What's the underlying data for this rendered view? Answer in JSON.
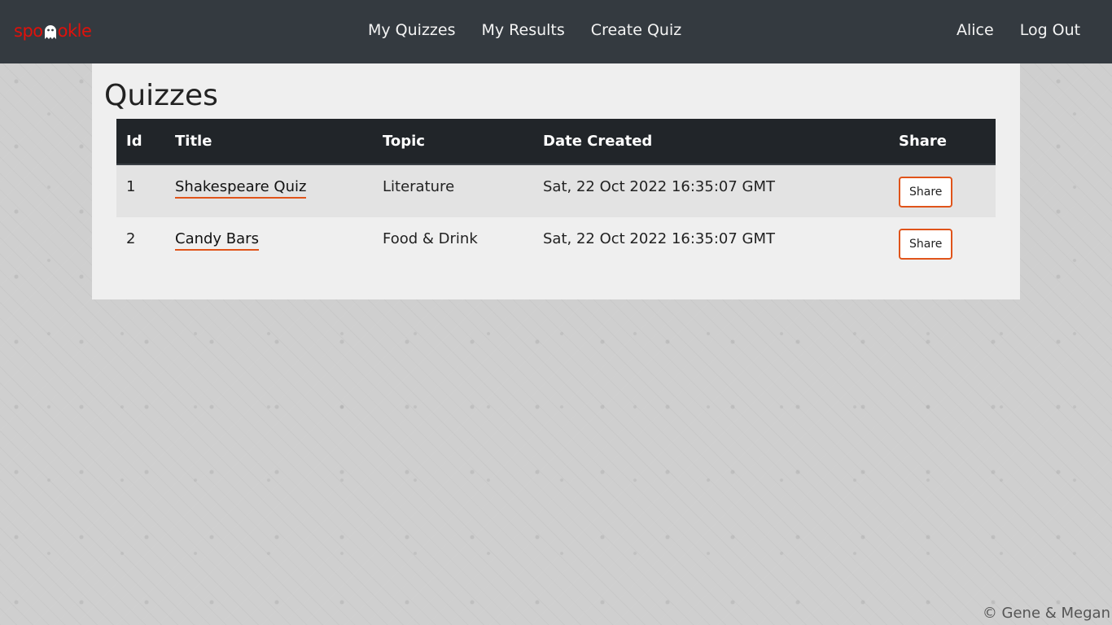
{
  "brand": {
    "prefix": "spo",
    "suffix": "okle",
    "color": "#e0110b"
  },
  "nav": {
    "links": [
      "My Quizzes",
      "My Results",
      "Create Quiz"
    ],
    "user": "Alice",
    "logout": "Log Out"
  },
  "page": {
    "title": "Quizzes"
  },
  "table": {
    "headers": [
      "Id",
      "Title",
      "Topic",
      "Date Created",
      "Share"
    ],
    "rows": [
      {
        "id": "1",
        "title": "Shakespeare Quiz",
        "topic": "Literature",
        "date": "Sat, 22 Oct 2022 16:35:07 GMT",
        "share": "Share"
      },
      {
        "id": "2",
        "title": "Candy Bars",
        "topic": "Food & Drink",
        "date": "Sat, 22 Oct 2022 16:35:07 GMT",
        "share": "Share"
      }
    ]
  },
  "footer": {
    "text": "© Gene & Megan"
  },
  "colors": {
    "navbar": "#343a40",
    "table_header": "#212529",
    "accent": "#e0541a"
  }
}
